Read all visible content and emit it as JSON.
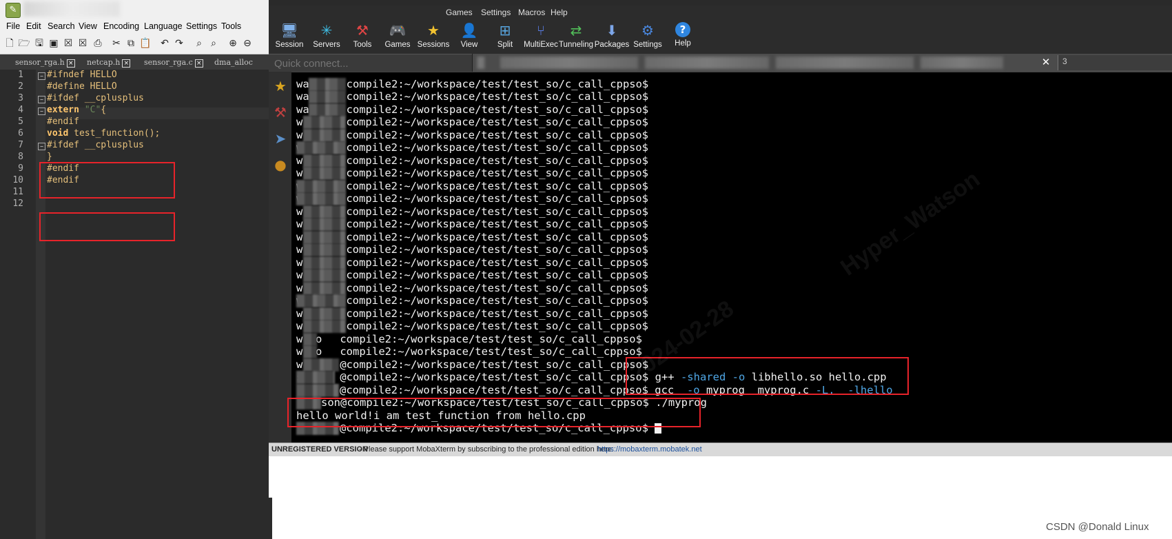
{
  "npp": {
    "menu": [
      "File",
      "Edit",
      "Search",
      "View",
      "Encoding",
      "Language",
      "Settings",
      "Tools"
    ],
    "tabs": [
      "sensor_rga.h",
      "netcap.h",
      "sensor_rga.c",
      "dma_alloc"
    ],
    "line_numbers": [
      "1",
      "2",
      "3",
      "4",
      "5",
      "6",
      "7",
      "8",
      "9",
      "10",
      "11",
      "12"
    ],
    "code": {
      "l1": "#ifndef HELLO",
      "l2": "#define HELLO",
      "l3": "#ifdef __cplusplus",
      "l4_kw": "extern",
      "l4_str": " \"C\"",
      "l4_rest": "{",
      "l5": "#endif",
      "l6_kw": "void",
      "l6_rest": " test_function();",
      "l7": "#ifdef __cplusplus",
      "l8": "}",
      "l9": "#endif",
      "l10": "#endif"
    }
  },
  "mx": {
    "menu": [
      "Games",
      "Settings",
      "Macros",
      "Help"
    ],
    "toolbar": [
      "Session",
      "Servers",
      "Tools",
      "Games",
      "Sessions",
      "View",
      "Split",
      "MultiExec",
      "Tunneling",
      "Packages",
      "Settings",
      "Help"
    ],
    "quick_connect_placeholder": "Quick connect...",
    "tab_extra": "3",
    "terminal": {
      "prompt_tail": "compile2:~/workspace/test/test_so/c_call_cppso$",
      "prompt_tail_at": "@compile2:~/workspace/test/test_so/c_call_cppso$",
      "prefix_wa": "wa",
      "prefix_w": "w",
      "prefix_wso": "w so",
      "prefix_s": "s",
      "prefix_son": "son",
      "cmd_gpp": " g++ ",
      "cmd_gpp_shared": "-shared",
      "cmd_gpp_o": "-o",
      "cmd_gpp_rest": " libhello.so hello.cpp",
      "cmd_gcc": " gcc  ",
      "cmd_gcc_o": "-o",
      "cmd_gcc_mid": " myprog  myprog.c ",
      "cmd_gcc_L": "-L.",
      "cmd_gcc_l": "  -lhello",
      "cmd_run": " ./myprog",
      "output": "hello world!i am test_function from hello.cpp"
    },
    "status": {
      "unregistered": "UNREGISTERED VERSION",
      "message": " -  Please support MobaXterm by subscribing to the professional edition here:",
      "link": "https://mobaxterm.mobatek.net"
    }
  },
  "watermark": "CSDN @Donald Linux",
  "colors": {
    "highlight_box": "#e8232a",
    "terminal_option": "#4fa7e6",
    "editor_bg": "#2b2b2b",
    "terminal_bg": "#000000"
  }
}
